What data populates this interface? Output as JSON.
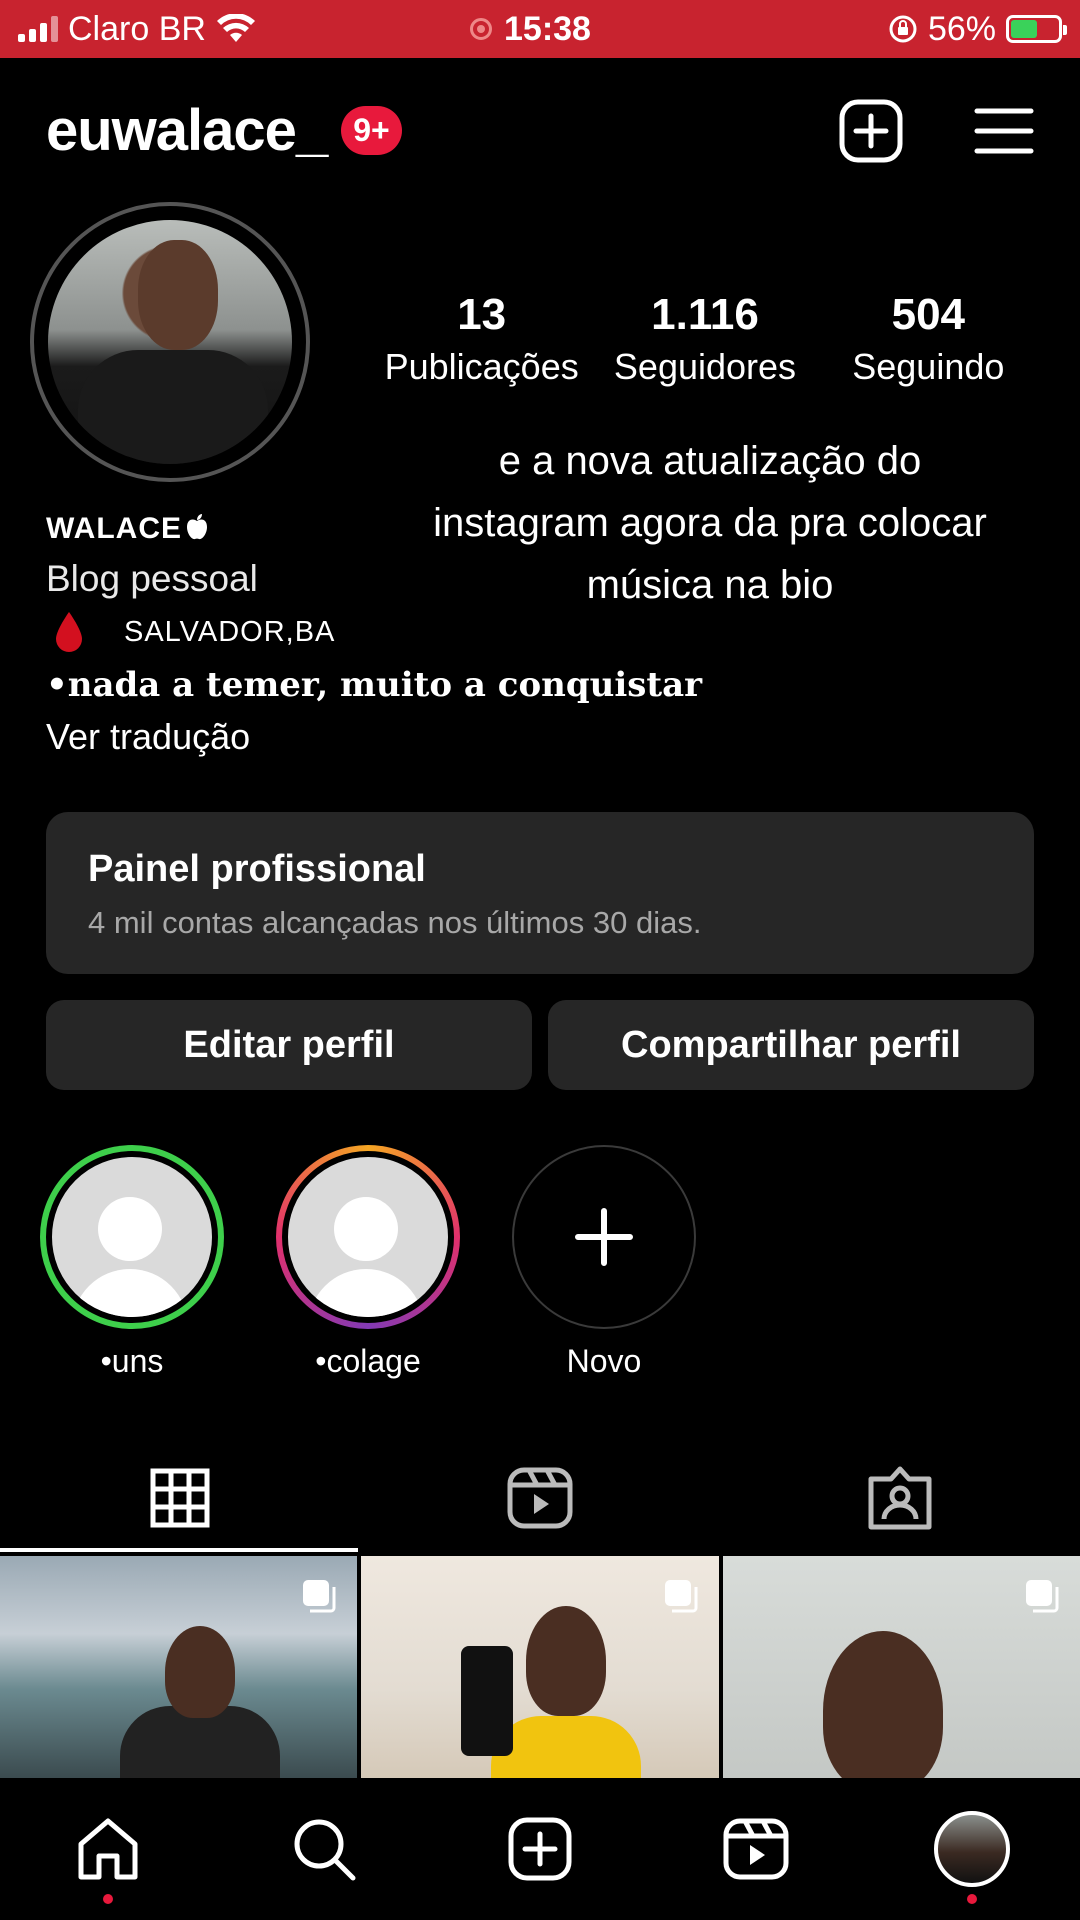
{
  "status_bar": {
    "carrier": "Claro BR",
    "time": "15:38",
    "battery_percent": "56%",
    "battery_level": 0.56
  },
  "header": {
    "username": "euwalace_",
    "notification_badge": "9+"
  },
  "profile": {
    "stats": [
      {
        "value": "13",
        "label": "Publicações"
      },
      {
        "value": "1.116",
        "label": "Seguidores"
      },
      {
        "value": "504",
        "label": "Seguindo"
      }
    ],
    "note": "e a nova atualização do instagram agora da pra colocar música na bio",
    "name": "WALACE",
    "category": "Blog pessoal",
    "location": "SALVADOR,BA",
    "motto": "•nada a temer, muito a conquistar",
    "translate_link": "Ver tradução"
  },
  "panel": {
    "title": "Painel profissional",
    "subtitle": "4 mil contas alcançadas nos últimos 30 dias."
  },
  "buttons": {
    "edit": "Editar perfil",
    "share": "Compartilhar perfil"
  },
  "highlights": [
    {
      "label": "•uns",
      "ring": "#3ecf4b"
    },
    {
      "label": "•colage",
      "ring": "gradient"
    },
    {
      "label": "Novo",
      "ring": "none"
    }
  ],
  "colors": {
    "status_bar": "#c8232f",
    "badge": "#e8193c",
    "panel": "#262626"
  },
  "icons": [
    "plus-square-icon",
    "menu-icon",
    "grid-icon",
    "reels-icon",
    "tagged-icon",
    "home-icon",
    "search-icon",
    "create-icon",
    "reels-nav-icon"
  ]
}
